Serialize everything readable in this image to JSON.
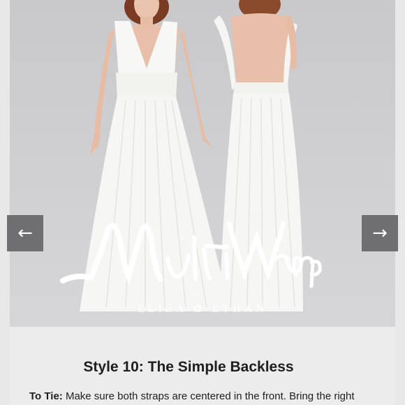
{
  "gallery": {
    "prev_arrow": "←",
    "next_arrow": "→",
    "brand": {
      "script_name": "MultiWrap",
      "by": "by",
      "maker": "ELIZA ✿ ETHAN"
    }
  },
  "content": {
    "style_title": "Style 10: The Simple Backless",
    "instructions_label": "To Tie:",
    "instructions_text": " Make sure both straps are centered in the front. Bring the right"
  },
  "colors": {
    "photo_background": "#cfcfd2",
    "dress": "#f6f6f4",
    "nav_button": "#6f6f71"
  }
}
